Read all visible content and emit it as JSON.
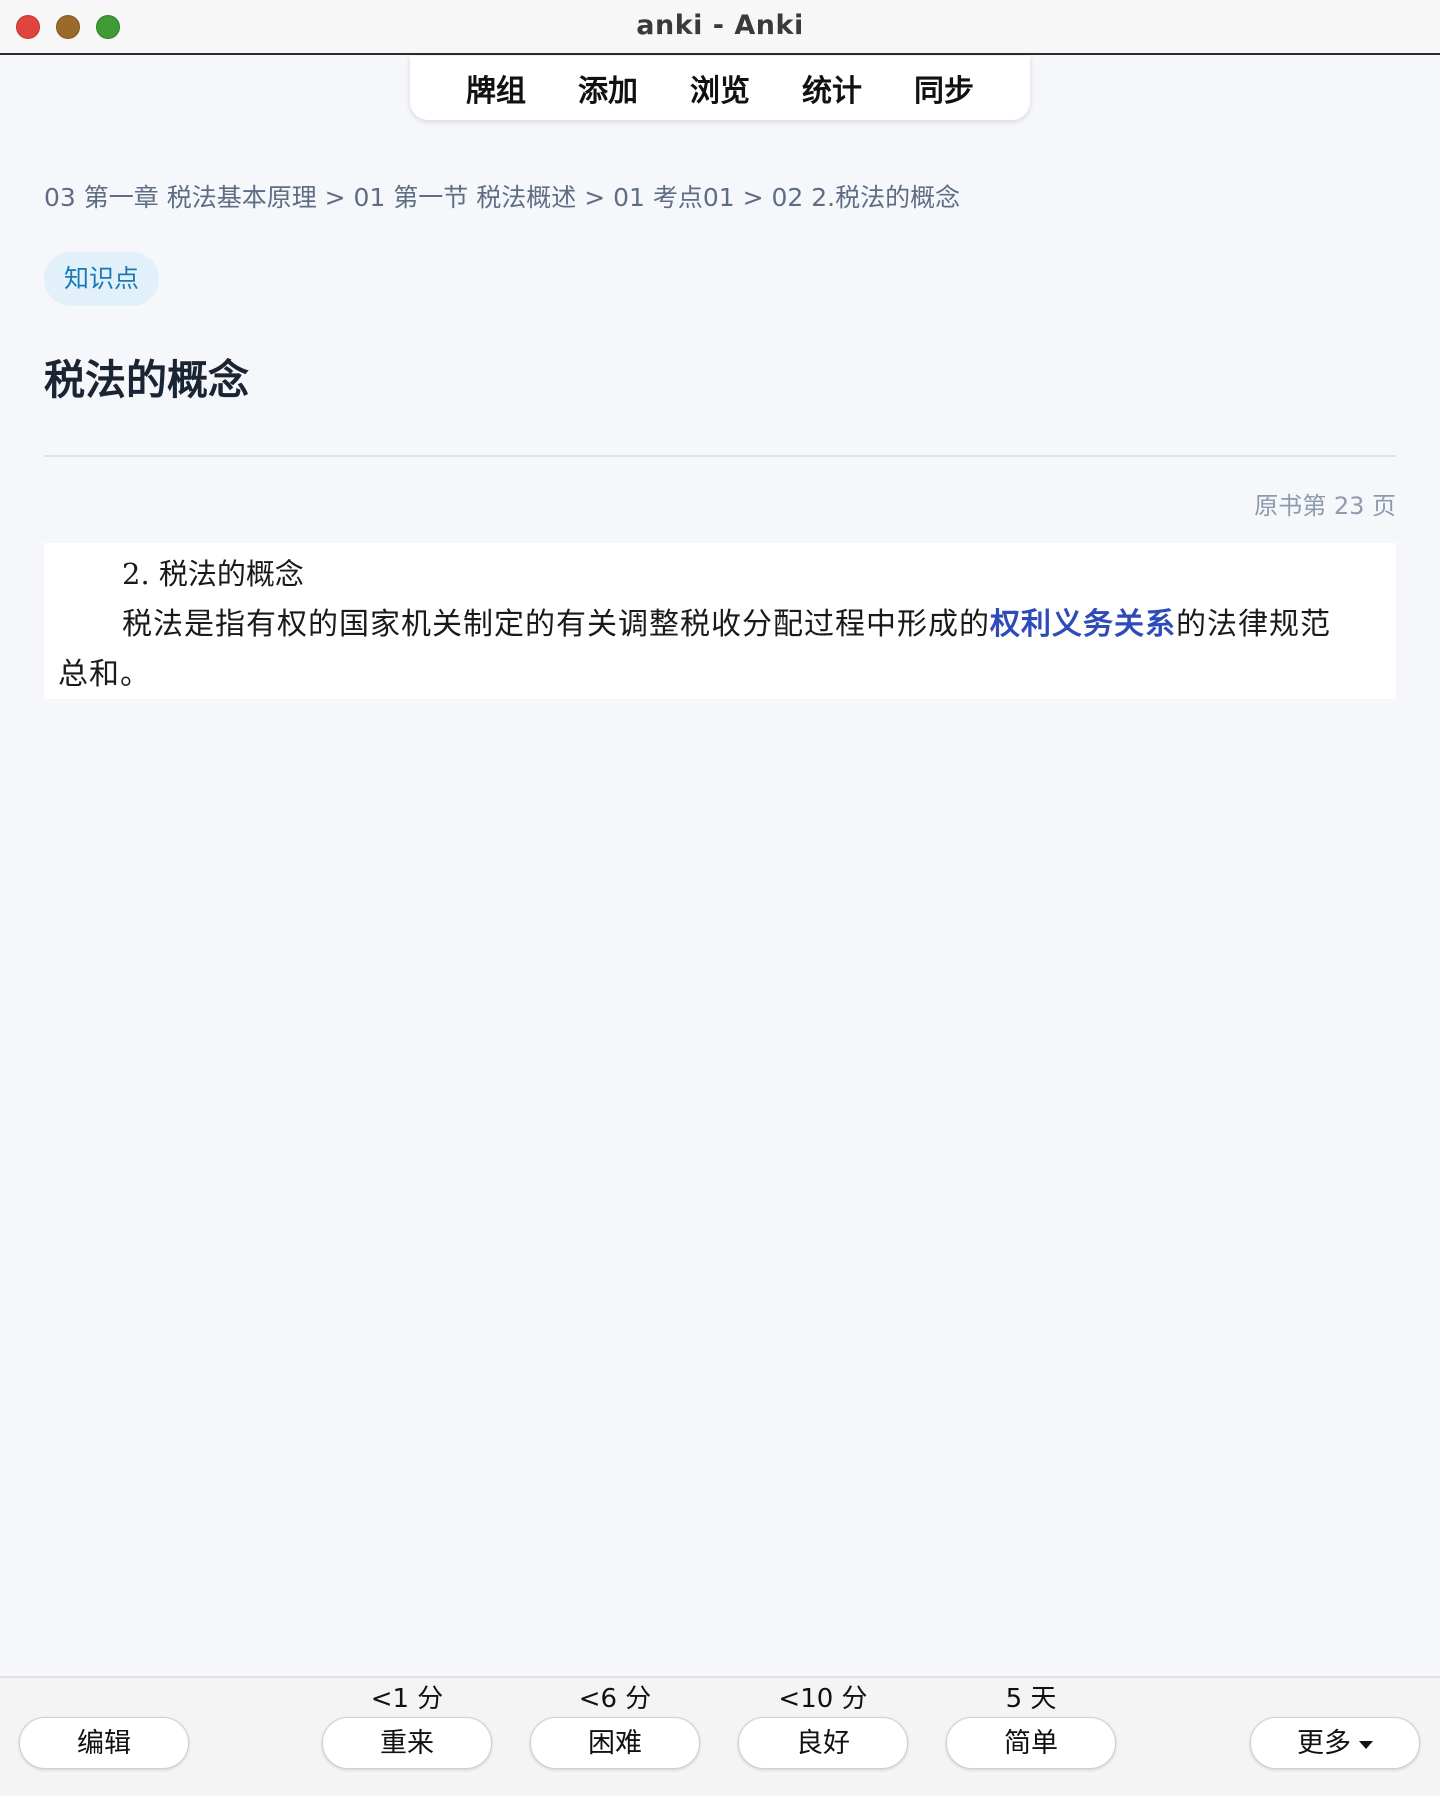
{
  "window": {
    "title": "anki - Anki"
  },
  "toolbar": {
    "tabs": [
      "牌组",
      "添加",
      "浏览",
      "统计",
      "同步"
    ]
  },
  "card": {
    "breadcrumb": "03 第一章 税法基本原理 > 01 第一节 税法概述 > 01 考点01 > 02 2.税法的概念",
    "badge": "知识点",
    "title": "税法的概念",
    "page_ref": "原书第 23 页",
    "scan": {
      "heading": "2. 税法的概念",
      "text_before": "税法是指有权的国家机关制定的有关调整税收分配过程中形成的",
      "highlight": "权利义务关系",
      "text_after": "的法律规范",
      "text_line2": "总和。"
    }
  },
  "answer_bar": {
    "edit_label": "编辑",
    "more_label": "更多",
    "buttons": [
      {
        "label": "重来",
        "interval": "<1 分"
      },
      {
        "label": "困难",
        "interval": "<6 分"
      },
      {
        "label": "良好",
        "interval": "<10 分"
      },
      {
        "label": "简单",
        "interval": "5 天"
      }
    ]
  },
  "colors": {
    "background": "#f6f7fb",
    "badge_bg": "#e2f0fa",
    "badge_text": "#1a7ab8",
    "highlight": "#2f4bb8",
    "traffic_red": "#e0443e",
    "traffic_yellow": "#9a6a2a",
    "traffic_green": "#3f9b35"
  }
}
